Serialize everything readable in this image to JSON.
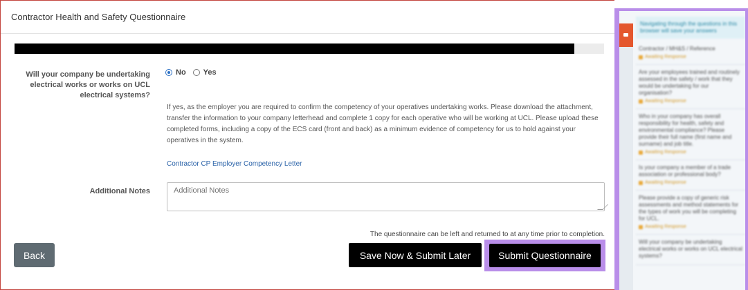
{
  "page": {
    "title": "Contractor Health and Safety Questionnaire"
  },
  "progress": {
    "fraction": 0.95
  },
  "question": {
    "label": "Will your company be undertaking electrical works or works on UCL electrical systems?",
    "options": [
      {
        "label": "No",
        "selected": true
      },
      {
        "label": "Yes",
        "selected": false
      }
    ],
    "info": "If yes, as the employer you are required to confirm the competency of your operatives undertaking works. Please download the attachment, transfer the information to your company letterhead and complete 1 copy for each operative who will be working at UCL. Please upload these completed forms, including a copy of the ECS card (front and back) as a minimum evidence of competency for us to hold against your operatives in the system.",
    "link_text": "Contractor CP Employer Competency Letter"
  },
  "notes": {
    "label": "Additional Notes",
    "placeholder": "Additional Notes",
    "value": ""
  },
  "footer": {
    "note": "The questionnaire can be left and returned to at any time prior to completion.",
    "back_label": "Back",
    "save_label": "Save Now & Submit Later",
    "submit_label": "Submit Questionnaire"
  },
  "sidebar": {
    "banner": "Navigating through the questions in this browser will save your answers",
    "items": [
      {
        "question": "Contractor / MH&S / Reference",
        "status": "Awaiting Response"
      },
      {
        "question": "Are your employees trained and routinely assessed in the safety / work that they would be undertaking for our organisation?",
        "status": "Awaiting Response"
      },
      {
        "question": "Who in your company has overall responsibility for health, safety and environmental compliance? Please provide their full name (first name and surname) and job title.",
        "status": "Awaiting Response"
      },
      {
        "question": "Is your company a member of a trade association or professional body?",
        "status": "Awaiting Response"
      },
      {
        "question": "Please provide a copy of generic risk assessments and method statements for the types of work you will be completing for UCL.",
        "status": "Awaiting Response"
      },
      {
        "question": "Will your company be undertaking electrical works or works on UCL electrical systems?",
        "status": ""
      }
    ]
  },
  "colors": {
    "accent_purple": "#b98ee9",
    "link_blue": "#2a62a8",
    "frame_red": "#c3443d",
    "sidebar_orange": "#e4572e",
    "status_amber": "#d49a2a"
  }
}
